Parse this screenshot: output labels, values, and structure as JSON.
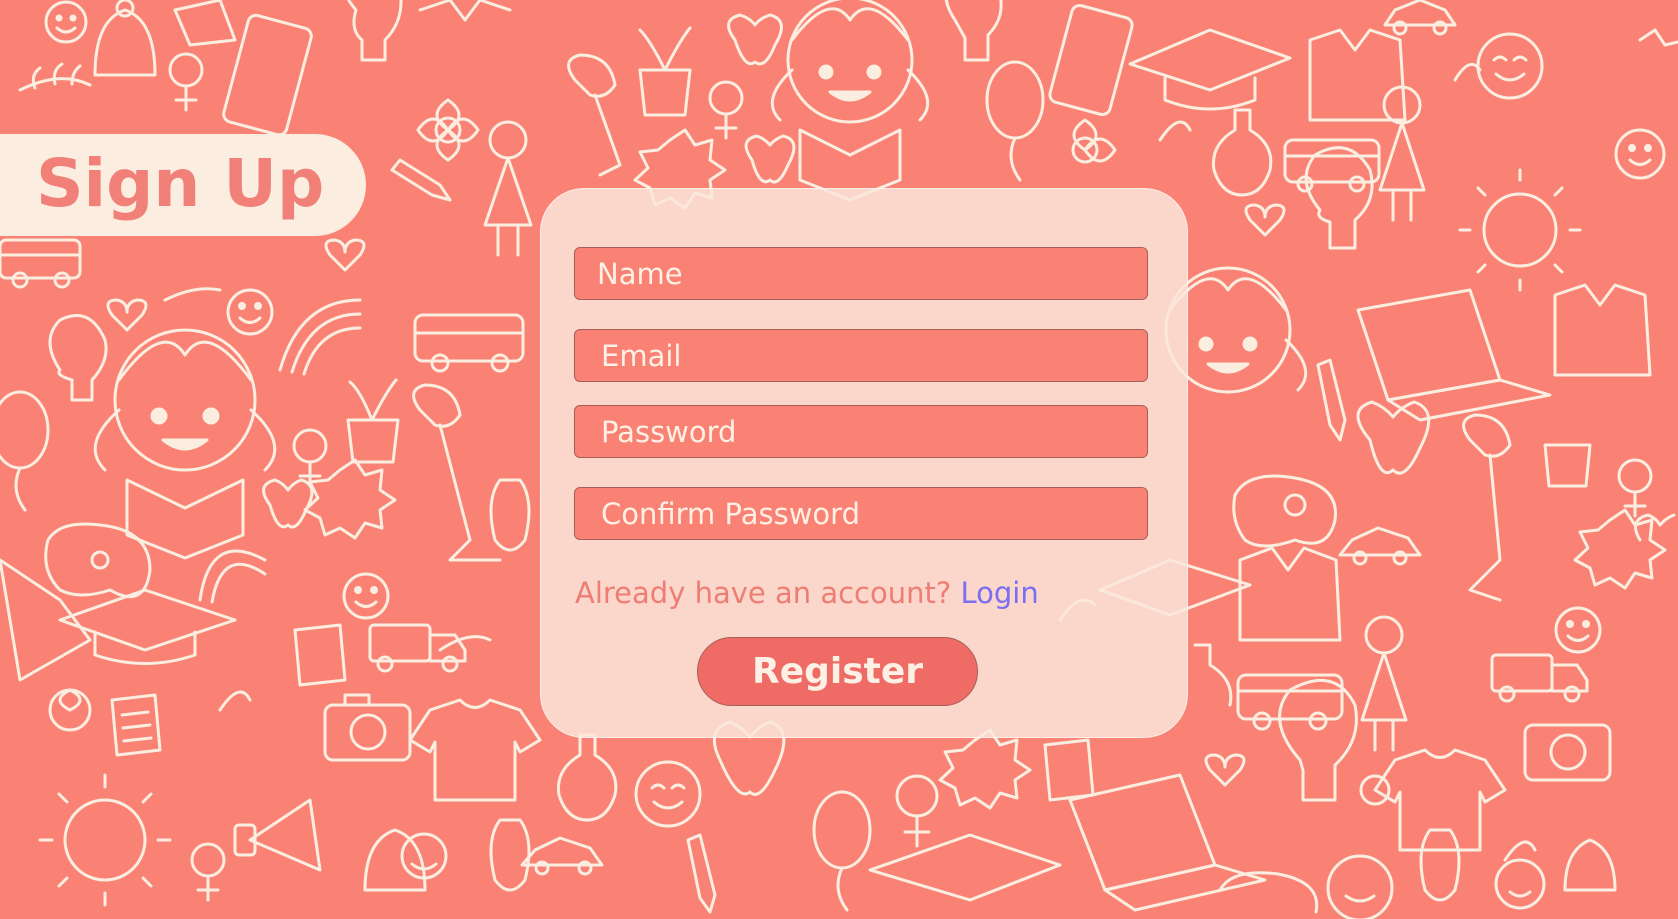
{
  "page": {
    "title": "Sign Up"
  },
  "form": {
    "name_placeholder": "Name",
    "email_placeholder": "Email",
    "password_placeholder": "Password",
    "confirm_placeholder": "Confirm Password",
    "account_prompt": "Already have an account?",
    "login_label": "Login",
    "register_label": "Register"
  },
  "background": {
    "pattern": "school-doodle-pattern",
    "icons": [
      "smiley-icon",
      "girl-reading-icon",
      "light-bulb-icon",
      "apple-icon",
      "bus-icon",
      "graduation-cap-icon",
      "rainbow-icon",
      "game-controller-icon",
      "camera-icon",
      "phone-icon",
      "sun-icon",
      "award-badge-icon",
      "laptop-icon",
      "female-symbol-icon",
      "flower-icon",
      "balloon-icon",
      "heart-icon",
      "pencil-icon"
    ]
  },
  "colors": {
    "background": "#f98274",
    "accent_cream": "#fbeee0",
    "title_text": "#f08078",
    "input_fill": "#f98274",
    "link": "#7b6ef0",
    "button": "#ef6b66"
  }
}
